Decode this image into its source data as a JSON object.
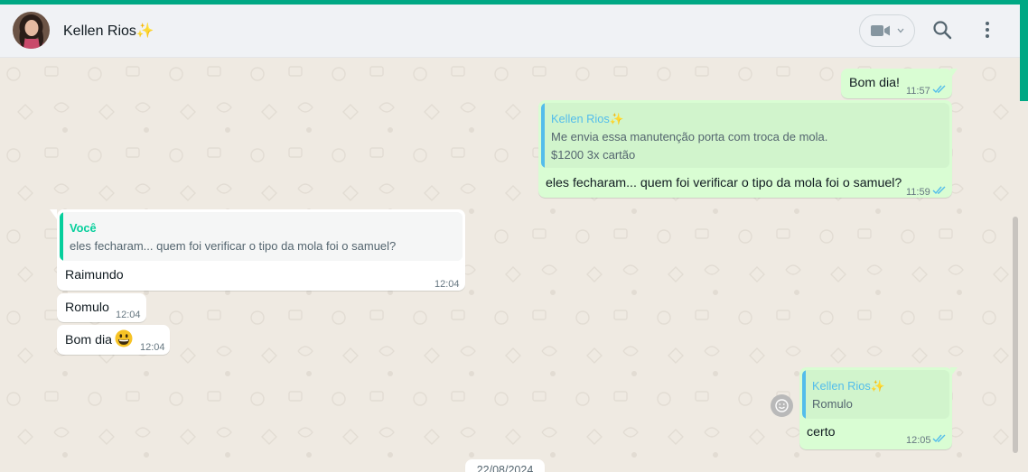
{
  "header": {
    "contact_name": "Kellen Rios✨"
  },
  "colors": {
    "accent": "#00a884",
    "outgoing_bubble": "#d9fdd3",
    "incoming_bubble": "#ffffff",
    "quote_name_contact": "#53bdeb",
    "quote_name_self": "#06cf9c",
    "read_ticks": "#53bdeb"
  },
  "messages": {
    "m1": {
      "text": "Bom dia!",
      "time": "11:57"
    },
    "m2": {
      "quote_author": "Kellen Rios✨",
      "quote_line1": "Me envia essa manutenção porta com troca de mola.",
      "quote_line2": "$1200 3x cartão",
      "text": "eles fecharam... quem foi verificar o tipo da mola foi o samuel?",
      "time": "11:59"
    },
    "m3": {
      "quote_author": "Você",
      "quote_line1": "eles fecharam... quem foi verificar o tipo da mola foi o samuel?",
      "text": "Raimundo",
      "time": "12:04"
    },
    "m4": {
      "text": "Romulo",
      "time": "12:04"
    },
    "m5": {
      "text": "Bom dia",
      "emoji_icon": "grinning-face-icon",
      "time": "12:04"
    },
    "m6": {
      "quote_author": "Kellen Rios✨",
      "quote_line1": "Romulo",
      "text": "certo",
      "time": "12:05"
    }
  },
  "date_chip": "22/08/2024",
  "icons": {
    "avatar": "avatar",
    "video": "video-camera-icon",
    "dropdown": "chevron-down-icon",
    "search": "search-icon",
    "menu": "kebab-menu-icon",
    "reaction": "smiley-reaction-icon",
    "read": "double-check-icon"
  }
}
